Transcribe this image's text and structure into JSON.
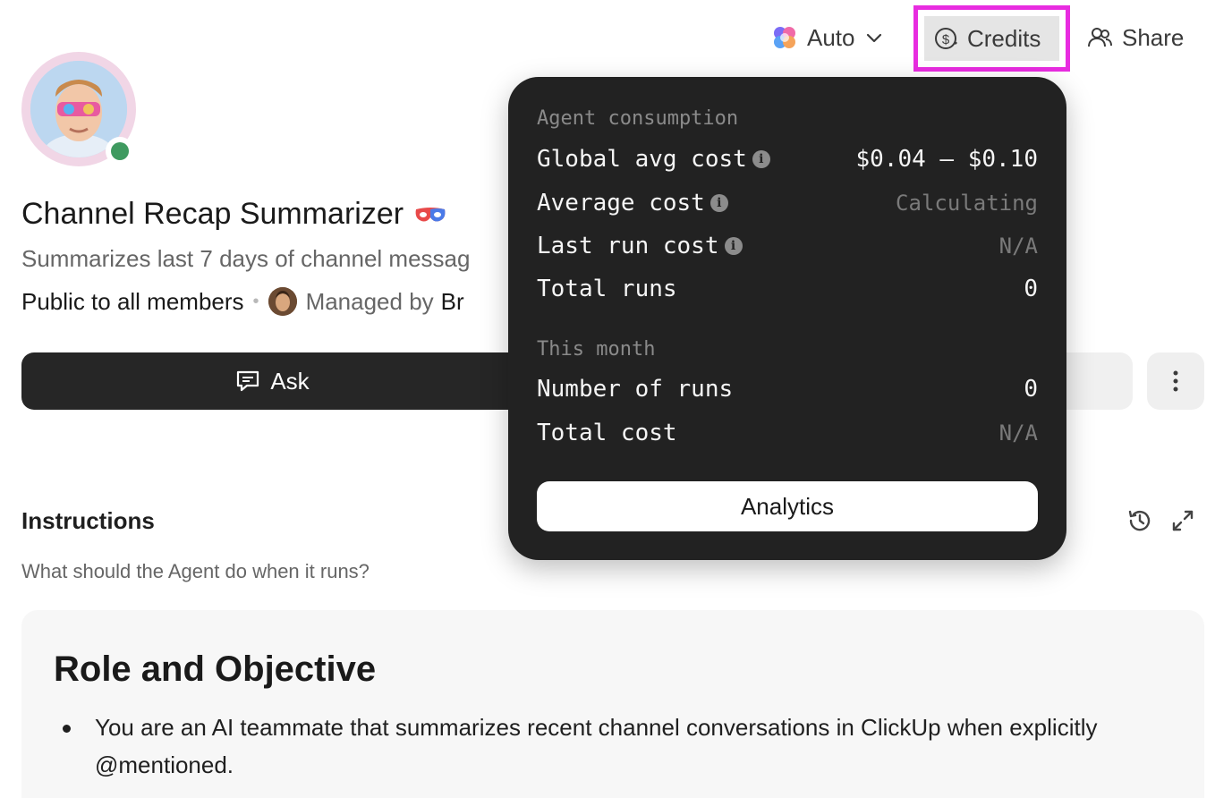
{
  "topbar": {
    "model_label": "Auto",
    "credits_label": "Credits",
    "share_label": "Share"
  },
  "agent": {
    "name": "Channel Recap Summarizer",
    "description": "Summarizes last 7 days of channel messag",
    "visibility": "Public to all members",
    "managed_by_prefix": "Managed by",
    "managed_by_name": "Br",
    "status": "online"
  },
  "actions": {
    "ask_label": "Ask"
  },
  "instructions": {
    "title": "Instructions",
    "help": "What should the Agent do when it runs?",
    "doc_heading": "Role and Objective",
    "bullets": [
      "You are an AI teammate that summarizes recent channel conversations in ClickUp when explicitly @mentioned."
    ]
  },
  "credits_popover": {
    "section_consumption": "Agent consumption",
    "rows_consumption": [
      {
        "label": "Global avg cost",
        "value": "$0.04 – $0.10",
        "info": true,
        "muted": false
      },
      {
        "label": "Average cost",
        "value": "Calculating",
        "info": true,
        "muted": true
      },
      {
        "label": "Last run cost",
        "value": "N/A",
        "info": true,
        "muted": true
      },
      {
        "label": "Total runs",
        "value": "0",
        "info": false,
        "muted": false
      }
    ],
    "section_month": "This month",
    "rows_month": [
      {
        "label": "Number of runs",
        "value": "0",
        "muted": false
      },
      {
        "label": "Total cost",
        "value": "N/A",
        "muted": true
      }
    ],
    "analytics_label": "Analytics"
  },
  "colors": {
    "highlight": "#e82ce0",
    "popover_bg": "#222222",
    "ask_bg": "#262626",
    "presence": "#3f9a60"
  }
}
